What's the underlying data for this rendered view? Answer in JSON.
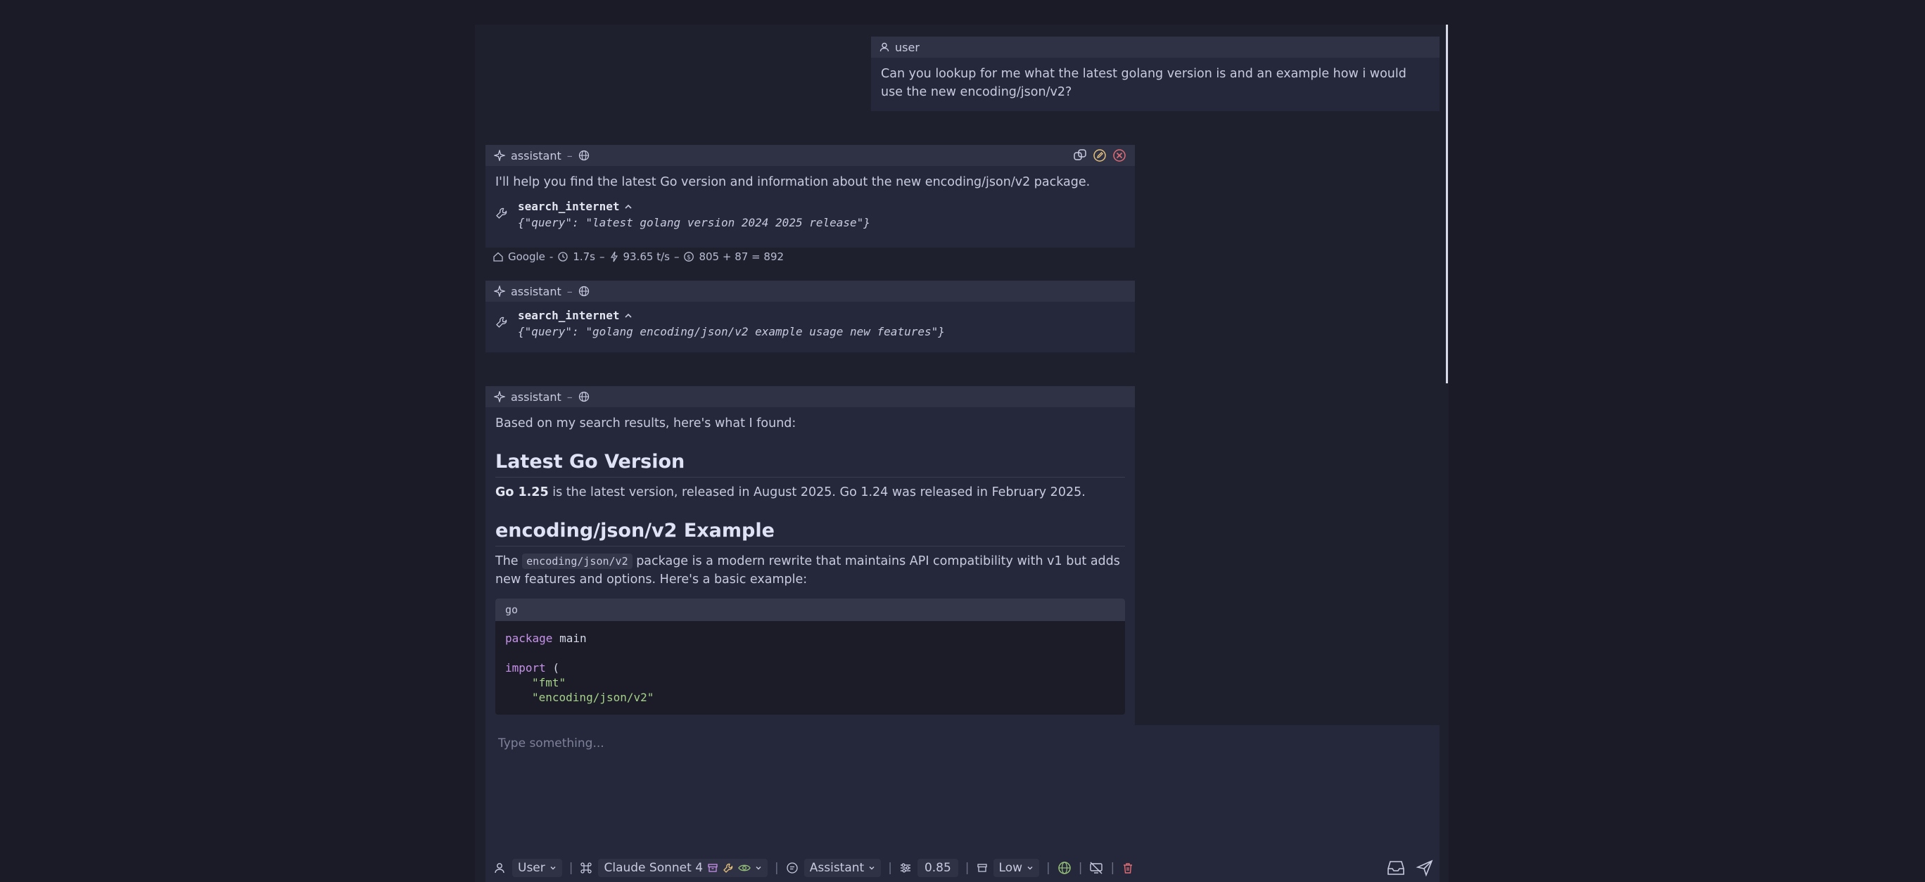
{
  "user_message": {
    "role": "user",
    "text": "Can you lookup for me what the latest golang version is and an example how i would use the new encoding/json/v2?"
  },
  "assistant_1": {
    "role": "assistant",
    "intro": "I'll help you find the latest Go version and information about the new encoding/json/v2 package.",
    "tool_name": "search_internet",
    "tool_args": "{\"query\": \"latest golang version 2024 2025 release\"}",
    "meta": {
      "provider": "Google",
      "time": "1.7s",
      "speed": "93.65 t/s",
      "tokens": "805 + 87 = 892"
    }
  },
  "assistant_2": {
    "role": "assistant",
    "tool_name": "search_internet",
    "tool_args": "{\"query\": \"golang encoding/json/v2 example usage new features\"}"
  },
  "assistant_3": {
    "role": "assistant",
    "intro": "Based on my search results, here's what I found:",
    "heading1": "Latest Go Version",
    "p1_bold": "Go 1.25",
    "p1_rest": " is the latest version, released in August 2025. Go 1.24 was released in February 2025.",
    "heading2": "encoding/json/v2 Example",
    "p2_pre": "The ",
    "p2_code": "encoding/json/v2",
    "p2_post": " package is a modern rewrite that maintains API compatibility with v1 but adds new features and options. Here's a basic example:",
    "code_lang": "go",
    "code_l1_kw": "package",
    "code_l1_rest": " main",
    "code_l2_kw": "import",
    "code_l2_rest": " (",
    "code_l3": "\"fmt\"",
    "code_l4": "\"encoding/json/v2\""
  },
  "composer": {
    "placeholder": "Type something..."
  },
  "toolbar": {
    "user_select": "User",
    "model_select": "Claude Sonnet 4",
    "persona_select": "Assistant",
    "temperature": "0.85",
    "effort_select": "Low"
  },
  "icons": {
    "user": "user-icon",
    "assistant": "sparkle-icon",
    "globe": "globe-icon",
    "wrench": "wrench-icon",
    "copy": "copy-icon",
    "edit": "edit-icon",
    "delete": "delete-icon",
    "send": "send-icon",
    "inbox": "inbox-icon"
  },
  "colors": {
    "background": "#1a1b26",
    "panel": "#1e202e",
    "bubble": "#25283a",
    "header": "#2f3245",
    "copy_icon": "#c8cbe0",
    "edit_icon": "#e5c07b",
    "delete_icon": "#e06c75",
    "eye_icon": "#98c379",
    "tools_icon": "#e5c07b",
    "archive_icon": "#c792ea"
  }
}
